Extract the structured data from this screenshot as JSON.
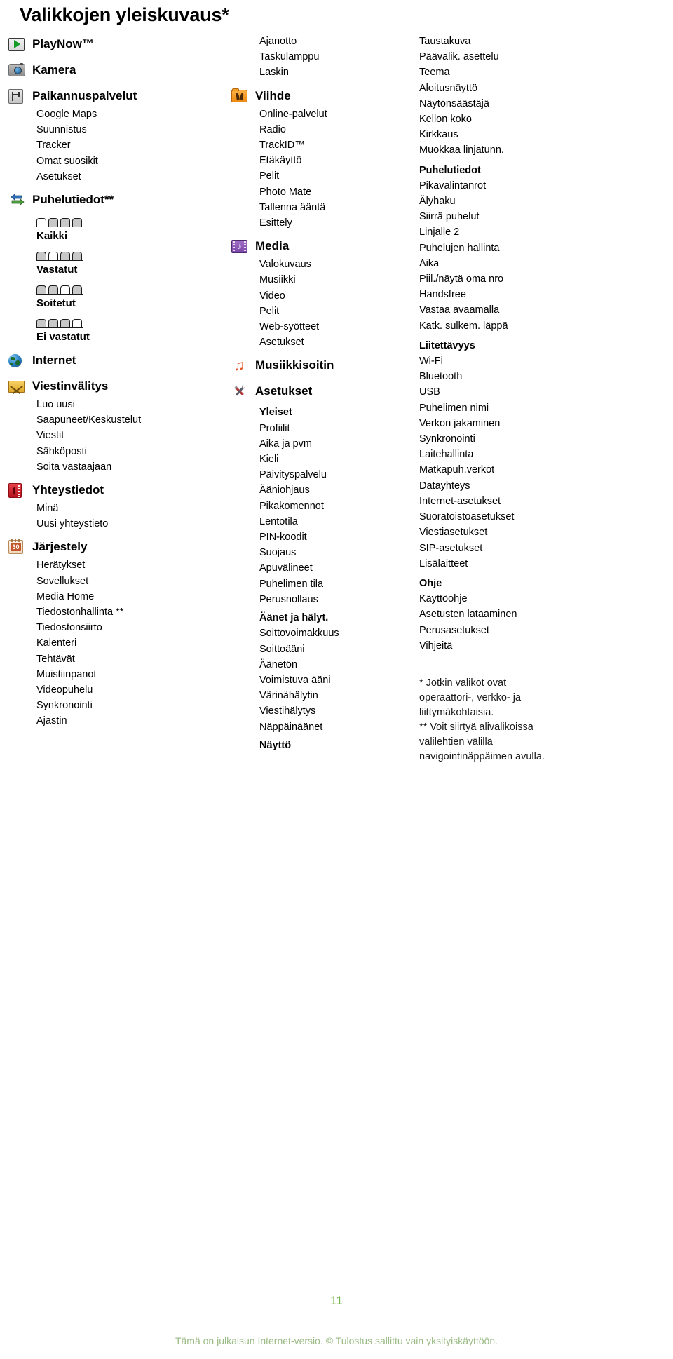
{
  "title": "Valikkojen yleiskuvaus*",
  "page_number": "11",
  "footer_note": "Tämä on julkaisun Internet-versio. © Tulostus sallittu vain yksityiskäyttöön.",
  "colors": {
    "page_number": "#74b44a",
    "footer_note": "#9bbb86",
    "playnow_green": "#169a28",
    "mail_yellow": "#e0a82c",
    "contacts_red": "#b4121d",
    "folder_orange": "#ef8a12",
    "media_purple": "#7b46a8",
    "note_orange": "#e2582a"
  },
  "column1": {
    "groups": [
      {
        "icon": "playnow-icon",
        "label": "PlayNow™",
        "items": []
      },
      {
        "icon": "camera-icon",
        "label": "Kamera",
        "items": []
      },
      {
        "icon": "location-services-icon",
        "label": "Paikannuspalvelut",
        "items": [
          "Google Maps",
          "Suunnistus",
          "Tracker",
          "Omat suosikit",
          "Asetukset"
        ]
      },
      {
        "icon": "call-log-icon",
        "label": "Puhelutiedot**",
        "items": [],
        "tabs": [
          {
            "label": "Kaikki",
            "active": 0,
            "icon": "call-tab-all-icon"
          },
          {
            "label": "Vastatut",
            "active": 1,
            "icon": "call-tab-answered-icon"
          },
          {
            "label": "Soitetut",
            "active": 2,
            "icon": "call-tab-dialled-icon"
          },
          {
            "label": "Ei vastatut",
            "active": 3,
            "icon": "call-tab-missed-icon"
          }
        ]
      },
      {
        "icon": "globe-icon",
        "label": "Internet",
        "items": []
      },
      {
        "icon": "envelope-icon",
        "label": "Viestinvälitys",
        "items": [
          "Luo uusi",
          "Saapuneet/Keskustelut",
          "Viestit",
          "Sähköposti",
          "Soita vastaajaan"
        ]
      },
      {
        "icon": "contacts-icon",
        "label": "Yhteystiedot",
        "items": [
          "Minä",
          "Uusi yhteystieto"
        ]
      },
      {
        "icon": "calendar-icon",
        "label": "Järjestely",
        "calendar_day": "30",
        "items": [
          "Herätykset",
          "Sovellukset",
          "Media Home",
          "Tiedostonhallinta **",
          "Tiedostonsiirto",
          "Kalenteri",
          "Tehtävät",
          "Muistiinpanot",
          "Videopuhelu",
          "Synkronointi",
          "Ajastin"
        ]
      }
    ]
  },
  "column2": {
    "lead_items": [
      "Ajanotto",
      "Taskulamppu",
      "Laskin"
    ],
    "groups": [
      {
        "icon": "folder-icon",
        "label": "Viihde",
        "items": [
          "Online-palvelut",
          "Radio",
          "TrackID™",
          "Etäkäyttö",
          "Pelit",
          "Photo Mate",
          "Tallenna ääntä",
          "Esittely"
        ]
      },
      {
        "icon": "media-icon",
        "label": "Media",
        "items": [
          "Valokuvaus",
          "Musiikki",
          "Video",
          "Pelit",
          "Web-syötteet",
          "Asetukset"
        ]
      },
      {
        "icon": "music-note-icon",
        "label": "Musiikkisoitin",
        "items": []
      },
      {
        "icon": "tools-icon",
        "label": "Asetukset",
        "items": [
          {
            "text": "Yleiset",
            "bold": true
          },
          {
            "text": "Profiilit",
            "bold": false
          },
          {
            "text": "Aika ja pvm",
            "bold": false
          },
          {
            "text": "Kieli",
            "bold": false
          },
          {
            "text": "Päivityspalvelu",
            "bold": false
          },
          {
            "text": "Ääniohjaus",
            "bold": false
          },
          {
            "text": "Pikakomennot",
            "bold": false
          },
          {
            "text": "Lentotila",
            "bold": false
          },
          {
            "text": "PIN-koodit",
            "bold": false
          },
          {
            "text": "Suojaus",
            "bold": false
          },
          {
            "text": "Apuvälineet",
            "bold": false
          },
          {
            "text": "Puhelimen tila",
            "bold": false
          },
          {
            "text": "Perusnollaus",
            "bold": false
          },
          {
            "text": "Äänet ja hälyt.",
            "bold": true
          },
          {
            "text": "Soittovoimakkuus",
            "bold": false
          },
          {
            "text": "Soittoääni",
            "bold": false
          },
          {
            "text": "Äänetön",
            "bold": false
          },
          {
            "text": "Voimistuva ääni",
            "bold": false
          },
          {
            "text": "Värinähälytin",
            "bold": false
          },
          {
            "text": "Viestihälytys",
            "bold": false
          },
          {
            "text": "Näppäinäänet",
            "bold": false
          },
          {
            "text": "Näyttö",
            "bold": true
          }
        ]
      }
    ]
  },
  "column3": {
    "items": [
      {
        "text": "Taustakuva",
        "bold": false
      },
      {
        "text": "Päävalik. asettelu",
        "bold": false
      },
      {
        "text": "Teema",
        "bold": false
      },
      {
        "text": "Aloitusnäyttö",
        "bold": false
      },
      {
        "text": "Näytönsäästäjä",
        "bold": false
      },
      {
        "text": "Kellon koko",
        "bold": false
      },
      {
        "text": "Kirkkaus",
        "bold": false
      },
      {
        "text": "Muokkaa linjatunn.",
        "bold": false
      },
      {
        "text": "Puhelutiedot",
        "bold": true
      },
      {
        "text": "Pikavalintanrot",
        "bold": false
      },
      {
        "text": "Älyhaku",
        "bold": false
      },
      {
        "text": "Siirrä puhelut",
        "bold": false
      },
      {
        "text": "Linjalle 2",
        "bold": false
      },
      {
        "text": "Puhelujen hallinta",
        "bold": false
      },
      {
        "text": "Aika",
        "bold": false
      },
      {
        "text": "Piil./näytä oma nro",
        "bold": false
      },
      {
        "text": "Handsfree",
        "bold": false
      },
      {
        "text": "Vastaa avaamalla",
        "bold": false
      },
      {
        "text": "Katk. sulkem. läppä",
        "bold": false
      },
      {
        "text": "Liitettävyys",
        "bold": true
      },
      {
        "text": "Wi-Fi",
        "bold": false
      },
      {
        "text": "Bluetooth",
        "bold": false
      },
      {
        "text": "USB",
        "bold": false
      },
      {
        "text": "Puhelimen nimi",
        "bold": false
      },
      {
        "text": "Verkon jakaminen",
        "bold": false
      },
      {
        "text": "Synkronointi",
        "bold": false
      },
      {
        "text": "Laitehallinta",
        "bold": false
      },
      {
        "text": "Matkapuh.verkot",
        "bold": false
      },
      {
        "text": "Datayhteys",
        "bold": false
      },
      {
        "text": "Internet-asetukset",
        "bold": false
      },
      {
        "text": "Suoratoistoasetukset",
        "bold": false
      },
      {
        "text": "Viestiasetukset",
        "bold": false
      },
      {
        "text": "SIP-asetukset",
        "bold": false
      },
      {
        "text": "Lisälaitteet",
        "bold": false
      },
      {
        "text": "Ohje",
        "bold": true
      },
      {
        "text": "Käyttöohje",
        "bold": false
      },
      {
        "text": "Asetusten lataaminen",
        "bold": false
      },
      {
        "text": "Perusasetukset",
        "bold": false
      },
      {
        "text": "Vihjeitä",
        "bold": false
      }
    ],
    "footnotes": "* Jotkin valikot ovat\noperaattori-, verkko- ja\nliittymäkohtaisia.\n** Voit siirtyä alivalikoissa\nvälilehtien välillä\nnavigointinäppäimen avulla."
  }
}
